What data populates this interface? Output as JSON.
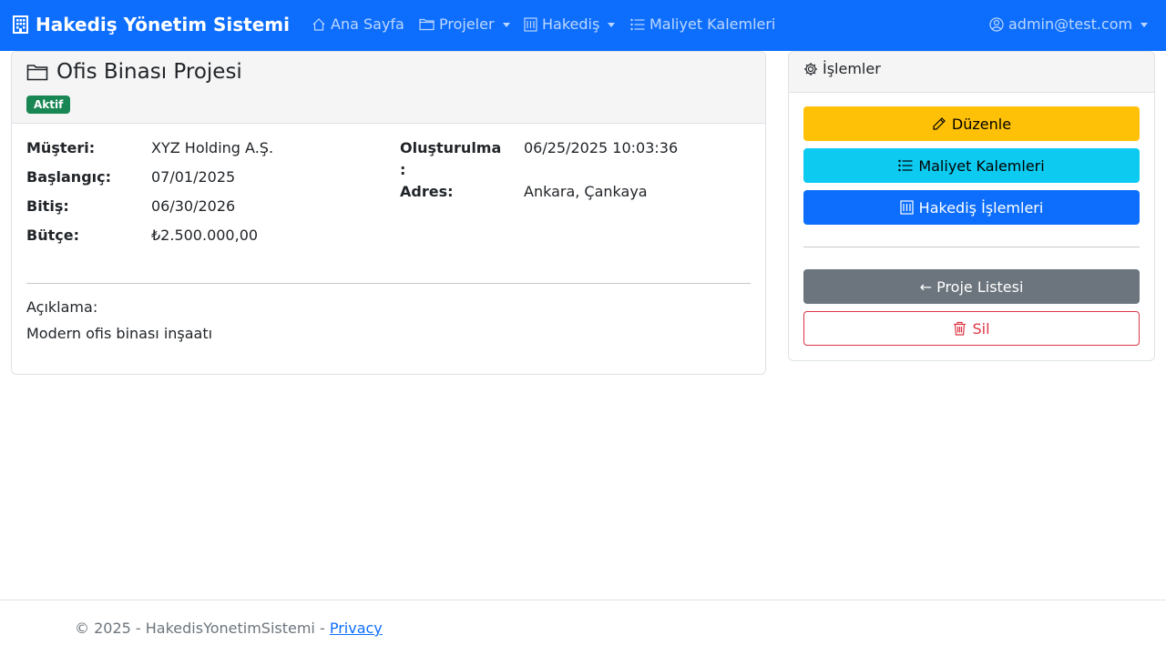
{
  "navbar": {
    "brand": "Hakediş Yönetim Sistemi",
    "brand_icon": "building-icon",
    "items": [
      {
        "label": "Ana Sayfa",
        "icon": "house-icon"
      },
      {
        "label": "Projeler",
        "icon": "folder-icon"
      },
      {
        "label": "Hakediş",
        "icon": "receipt-icon"
      },
      {
        "label": "Maliyet Kalemleri",
        "icon": "list-icon"
      }
    ],
    "user": "admin@test.com",
    "user_icon": "person-circle-icon",
    "background_color": "#0d6efd"
  },
  "project": {
    "title": "Ofis Binası Projesi",
    "status": "Aktif",
    "status_color": "#198754",
    "fields": {
      "musteri_label": "Müşteri:",
      "musteri": "XYZ Holding A.Ş.",
      "baslangic_label": "Başlangıç:",
      "baslangic": "07/01/2025",
      "bitis_label": "Bitiş:",
      "bitis": "06/30/2026",
      "butce_label": "Bütçe:",
      "butce": "₺2.500.000,00",
      "olusturulma_label_1": "Oluşturulma",
      "olusturulma_label_2": ":",
      "olusturulma": "06/25/2025 10:03:36",
      "adres_label": "Adres:",
      "adres": "Ankara, Çankaya"
    },
    "description_label": "Açıklama:",
    "description": "Modern ofis binası inşaatı"
  },
  "actions": {
    "title": "İşlemler",
    "edit": "Düzenle",
    "cost_items": "Maliyet Kalemleri",
    "progress_payments": "Hakediş İşlemleri",
    "project_list": "← Proje Listesi",
    "delete": "Sil"
  },
  "footer": {
    "copyright": "© 2025 - HakedisYonetimSistemi - ",
    "privacy": "Privacy"
  }
}
